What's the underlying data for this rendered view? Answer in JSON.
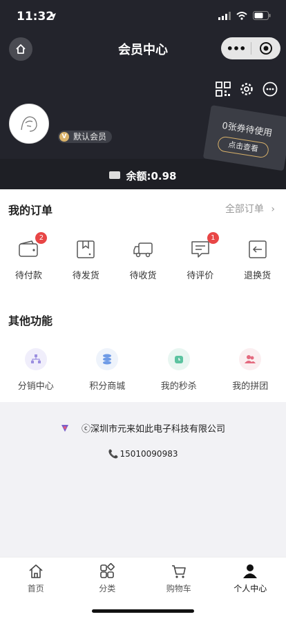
{
  "status_bar": {
    "time": "11:32"
  },
  "nav": {
    "title": "会员中心"
  },
  "profile": {
    "member_level": "默认会员",
    "badge_letter": "V"
  },
  "coupon": {
    "text": "0张券待使用",
    "button": "点击查看"
  },
  "balance": {
    "label": "余额:0.98"
  },
  "orders": {
    "title": "我的订单",
    "all_label": "全部订单",
    "items": [
      {
        "label": "待付款",
        "icon": "wallet-icon",
        "badge": "2"
      },
      {
        "label": "待发货",
        "icon": "package-icon",
        "badge": ""
      },
      {
        "label": "待收货",
        "icon": "truck-icon",
        "badge": ""
      },
      {
        "label": "待评价",
        "icon": "comment-icon",
        "badge": "1"
      },
      {
        "label": "退换货",
        "icon": "return-icon",
        "badge": ""
      }
    ]
  },
  "functions": {
    "title": "其他功能",
    "items": [
      {
        "label": "分销中心",
        "icon": "org-chart-icon",
        "color": "#f0eefb"
      },
      {
        "label": "积分商城",
        "icon": "coins-icon",
        "color": "#eef3fb"
      },
      {
        "label": "我的秒杀",
        "icon": "clock-icon",
        "color": "#e8f6f1"
      },
      {
        "label": "我的拼团",
        "icon": "group-icon",
        "color": "#fbeef0"
      }
    ]
  },
  "footer": {
    "company": "ⓒ深圳市元来如此电子科技有限公司",
    "phone": "15010090983"
  },
  "tabbar": {
    "items": [
      {
        "label": "首页",
        "icon": "home-icon"
      },
      {
        "label": "分类",
        "icon": "category-icon"
      },
      {
        "label": "购物车",
        "icon": "cart-icon"
      },
      {
        "label": "个人中心",
        "icon": "person-icon"
      }
    ]
  },
  "colors": {
    "header_bg": "#23242c",
    "badge_red": "#e84646",
    "gold": "#d9b26a"
  }
}
